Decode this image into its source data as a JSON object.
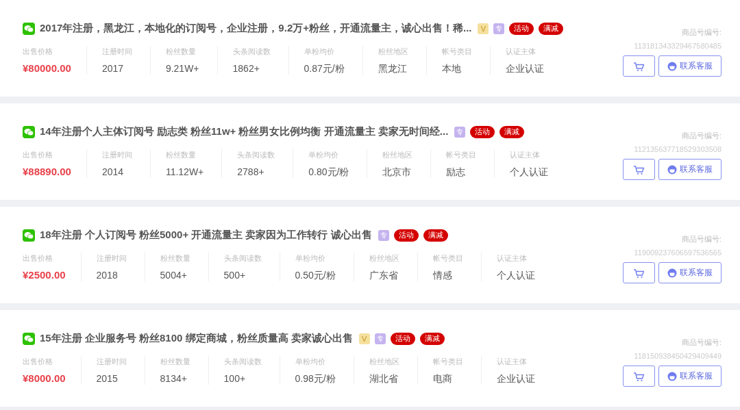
{
  "listings": [
    {
      "title": "2017年注册，黑龙江，本地化的订阅号，企业注册，9.2万+粉丝，开通流量主，诚心出售！稀...",
      "badges": [
        {
          "kind": "v",
          "text": "V"
        },
        {
          "kind": "zhuan",
          "text": "专"
        },
        {
          "kind": "tag",
          "text": "活动"
        },
        {
          "kind": "tag",
          "text": "满减"
        }
      ],
      "stats": [
        {
          "label": "出售价格",
          "value": "¥80000.00",
          "kind": "price"
        },
        {
          "label": "注册时间",
          "value": "2017",
          "kind": "plain"
        },
        {
          "label": "粉丝数量",
          "value": "9.21W+",
          "kind": "plain"
        },
        {
          "label": "头条阅读数",
          "value": "1862+",
          "kind": "plain"
        },
        {
          "label": "单粉均价",
          "value": "0.87元/粉",
          "kind": "plain"
        },
        {
          "label": "粉丝地区",
          "value": "黑龙江",
          "kind": "plain"
        },
        {
          "label": "帐号类目",
          "value": "本地",
          "kind": "plain"
        },
        {
          "label": "认证主体",
          "value": "企业认证",
          "kind": "plain"
        }
      ],
      "id_label": "商品号编号:",
      "id": "113181343329467580485",
      "contact": "联系客服"
    },
    {
      "title": "14年注册个人主体订阅号 励志类 粉丝11w+ 粉丝男女比例均衡 开通流量主 卖家无时间经...",
      "badges": [
        {
          "kind": "zhuan",
          "text": "专"
        },
        {
          "kind": "tag",
          "text": "活动"
        },
        {
          "kind": "tag",
          "text": "满减"
        }
      ],
      "stats": [
        {
          "label": "出售价格",
          "value": "¥88890.00",
          "kind": "price"
        },
        {
          "label": "注册时间",
          "value": "2014",
          "kind": "plain"
        },
        {
          "label": "粉丝数量",
          "value": "11.12W+",
          "kind": "plain"
        },
        {
          "label": "头条阅读数",
          "value": "2788+",
          "kind": "plain"
        },
        {
          "label": "单粉均价",
          "value": "0.80元/粉",
          "kind": "plain"
        },
        {
          "label": "粉丝地区",
          "value": "北京市",
          "kind": "plain"
        },
        {
          "label": "帐号类目",
          "value": "励志",
          "kind": "plain"
        },
        {
          "label": "认证主体",
          "value": "个人认证",
          "kind": "plain"
        }
      ],
      "id_label": "商品号编号:",
      "id": "112135637718529303508",
      "contact": "联系客服"
    },
    {
      "title": "18年注册 个人订阅号 粉丝5000+ 开通流量主 卖家因为工作转行 诚心出售",
      "badges": [
        {
          "kind": "zhuan",
          "text": "专"
        },
        {
          "kind": "tag",
          "text": "活动"
        },
        {
          "kind": "tag",
          "text": "满减"
        }
      ],
      "stats": [
        {
          "label": "出售价格",
          "value": "¥2500.00",
          "kind": "price"
        },
        {
          "label": "注册时间",
          "value": "2018",
          "kind": "plain"
        },
        {
          "label": "粉丝数量",
          "value": "5004+",
          "kind": "plain"
        },
        {
          "label": "头条阅读数",
          "value": "500+",
          "kind": "plain"
        },
        {
          "label": "单粉均价",
          "value": "0.50元/粉",
          "kind": "plain"
        },
        {
          "label": "粉丝地区",
          "value": "广东省",
          "kind": "plain"
        },
        {
          "label": "帐号类目",
          "value": "情感",
          "kind": "plain"
        },
        {
          "label": "认证主体",
          "value": "个人认证",
          "kind": "plain"
        }
      ],
      "id_label": "商品号编号:",
      "id": "119009237606597536565",
      "contact": "联系客服"
    },
    {
      "title": "15年注册 企业服务号 粉丝8100 绑定商城，粉丝质量高 卖家诚心出售",
      "badges": [
        {
          "kind": "v",
          "text": "V"
        },
        {
          "kind": "zhuan",
          "text": "专"
        },
        {
          "kind": "tag",
          "text": "活动"
        },
        {
          "kind": "tag",
          "text": "满减"
        }
      ],
      "stats": [
        {
          "label": "出售价格",
          "value": "¥8000.00",
          "kind": "price"
        },
        {
          "label": "注册时间",
          "value": "2015",
          "kind": "plain"
        },
        {
          "label": "粉丝数量",
          "value": "8134+",
          "kind": "plain"
        },
        {
          "label": "头条阅读数",
          "value": "100+",
          "kind": "plain"
        },
        {
          "label": "单粉均价",
          "value": "0.98元/粉",
          "kind": "plain"
        },
        {
          "label": "粉丝地区",
          "value": "湖北省",
          "kind": "plain"
        },
        {
          "label": "帐号类目",
          "value": "电商",
          "kind": "plain"
        },
        {
          "label": "认证主体",
          "value": "企业认证",
          "kind": "plain"
        }
      ],
      "id_label": "商品号编号:",
      "id": "118150938450429409449",
      "contact": "联系客服"
    }
  ]
}
